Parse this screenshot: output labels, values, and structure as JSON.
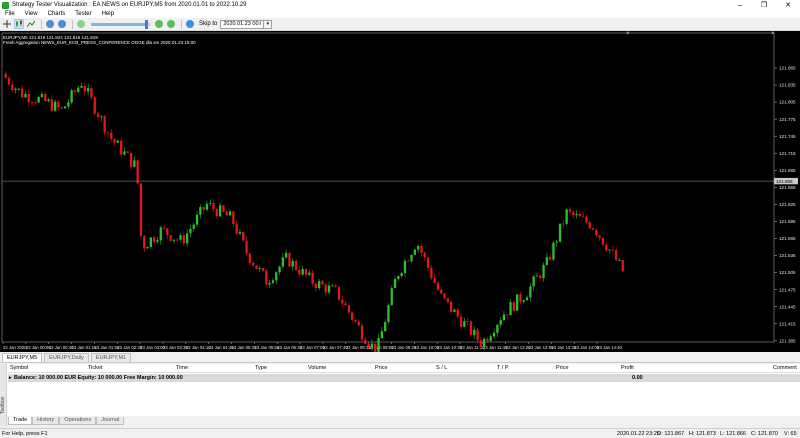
{
  "window": {
    "title": "Strategy Tester Visualization : EA NEWS on EURJPY,M5 from 2020.01.01 to 2022.10.29",
    "minimize": "–",
    "maximize": "❐",
    "close": "✕"
  },
  "menu": [
    "File",
    "View",
    "Charts",
    "Tester",
    "Help"
  ],
  "toolbar": {
    "skip_label": "Skip to",
    "skip_value": "2020.01.23 00:00",
    "speed_fraction": 0.92
  },
  "chart": {
    "symbol_line": "EURJPY,M5  121.819 121.824 121.816 121.819",
    "info_line": "Fresh Aggregation NEWS_EUR_ECB_PRESS_CONFERENCE OGGE dla xm 2020.01.23 15:00",
    "close_label": "×",
    "current_price": "121.666",
    "current_price_value": 121.666,
    "background": "#000000",
    "bull_color": "#2fbf2f",
    "bear_color": "#e01818",
    "price_axis": [
      "121.865",
      "121.835",
      "121.805",
      "121.775",
      "121.745",
      "121.715",
      "121.685",
      "121.655",
      "121.625",
      "121.595",
      "121.565",
      "121.535",
      "121.505",
      "121.475",
      "121.445",
      "121.415",
      "121.385"
    ],
    "time_axis": [
      "22 Jan 2020",
      "23 Jan 00:05",
      "23 Jan 00:40",
      "23 Jan 01:15",
      "23 Jan 01:50",
      "23 Jan 02:25",
      "23 Jan 03:00",
      "23 Jan 03:35",
      "23 Jan 04:10",
      "23 Jan 04:45",
      "23 Jan 05:20",
      "23 Jan 05:55",
      "23 Jan 06:30",
      "23 Jan 07:05",
      "23 Jan 07:40",
      "23 Jan 08:15",
      "23 Jan 08:50",
      "23 Jan 09:25",
      "23 Jan 10:00",
      "23 Jan 10:35",
      "23 Jan 11:10",
      "23 Jan 11:45",
      "23 Jan 12:20",
      "23 Jan 12:55",
      "23 Jan 13:30",
      "23 Jan 14:05",
      "23 Jan 14:40"
    ]
  },
  "chart_tabs": [
    {
      "label": "EURJPY,M5",
      "active": true
    },
    {
      "label": "EURJPY,Daily",
      "active": false
    },
    {
      "label": "EURJPY,M1",
      "active": false
    }
  ],
  "terminal": {
    "side_label": "Toolbox",
    "columns": [
      "Symbol",
      "Ticket",
      "Time",
      "Type",
      "Volume",
      "Price",
      "S / L",
      "T / P",
      "Price",
      "Profit",
      "Comment"
    ],
    "balance_text": "Balance: 10 000.00 EUR  Equity: 10 000.00  Free Margin: 10 000.00",
    "balance_profit": "0.00",
    "tabs": [
      {
        "label": "Trade",
        "active": true
      },
      {
        "label": "History",
        "active": false
      },
      {
        "label": "Operations",
        "active": false
      },
      {
        "label": "Journal",
        "active": false
      }
    ]
  },
  "status": {
    "help": "For Help, press F1",
    "time": "2020.01.22 23:25",
    "open": "O: 121.867",
    "high": "H: 121.873",
    "low": "L: 121.866",
    "close": "C: 121.870",
    "volume": "V: 65"
  }
}
